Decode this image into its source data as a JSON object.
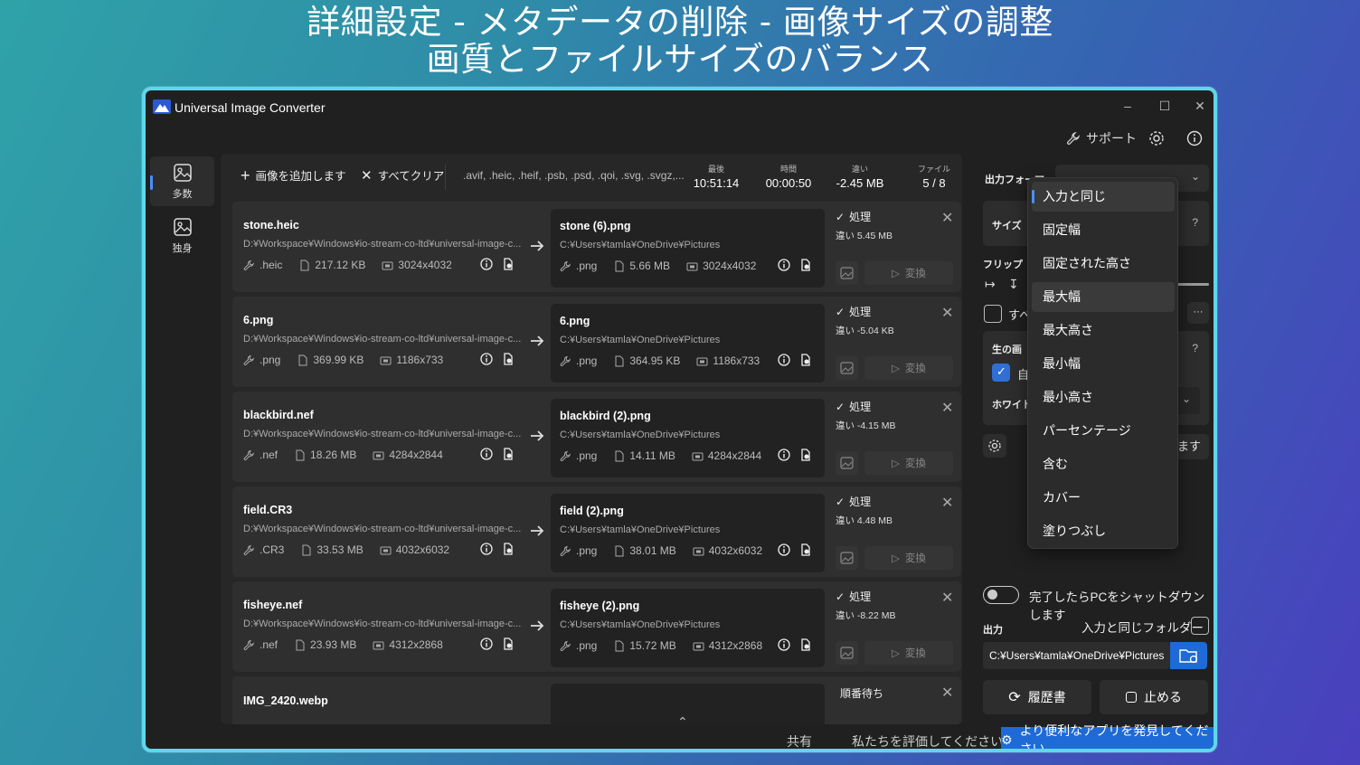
{
  "headline": {
    "line1": "詳細設定 - メタデータの削除 - 画像サイズの調整",
    "line2": "画質とファイルサイズのバランス"
  },
  "window": {
    "title": "Universal Image Converter",
    "support_label": "サポート"
  },
  "nav": [
    {
      "label": "多数"
    },
    {
      "label": "独身"
    }
  ],
  "toolbar": {
    "add_label": "画像を追加します",
    "clear_label": "すべてクリア",
    "extensions": ".avif, .heic, .heif, .psb, .psd, .qoi, .svg, .svgz,...",
    "stats": [
      {
        "label": "最後",
        "value": "10:51:14"
      },
      {
        "label": "時間",
        "value": "00:00:50"
      },
      {
        "label": "違い",
        "value": "-2.45 MB"
      },
      {
        "label": "ファイル",
        "value": "5 / 8"
      }
    ]
  },
  "files": [
    {
      "name": "stone.heic",
      "path": "D:¥Workspace¥Windows¥io-stream-co-ltd¥universal-image-c...",
      "ext": ".heic",
      "size": "217.12 KB",
      "dims": "3024x4032",
      "out": {
        "name": "stone (6).png",
        "path": "C:¥Users¥tamla¥OneDrive¥Pictures",
        "ext": ".png",
        "size": "5.66 MB",
        "dims": "3024x4032"
      },
      "status": "処理",
      "diff": "違い 5.45 MB",
      "convert": "変換"
    },
    {
      "name": "6.png",
      "path": "D:¥Workspace¥Windows¥io-stream-co-ltd¥universal-image-c...",
      "ext": ".png",
      "size": "369.99 KB",
      "dims": "1186x733",
      "out": {
        "name": "6.png",
        "path": "C:¥Users¥tamla¥OneDrive¥Pictures",
        "ext": ".png",
        "size": "364.95 KB",
        "dims": "1186x733"
      },
      "status": "処理",
      "diff": "違い -5.04 KB",
      "convert": "変換"
    },
    {
      "name": "blackbird.nef",
      "path": "D:¥Workspace¥Windows¥io-stream-co-ltd¥universal-image-c...",
      "ext": ".nef",
      "size": "18.26 MB",
      "dims": "4284x2844",
      "out": {
        "name": "blackbird (2).png",
        "path": "C:¥Users¥tamla¥OneDrive¥Pictures",
        "ext": ".png",
        "size": "14.11 MB",
        "dims": "4284x2844"
      },
      "status": "処理",
      "diff": "違い -4.15 MB",
      "convert": "変換"
    },
    {
      "name": "field.CR3",
      "path": "D:¥Workspace¥Windows¥io-stream-co-ltd¥universal-image-c...",
      "ext": ".CR3",
      "size": "33.53 MB",
      "dims": "4032x6032",
      "out": {
        "name": "field (2).png",
        "path": "C:¥Users¥tamla¥OneDrive¥Pictures",
        "ext": ".png",
        "size": "38.01 MB",
        "dims": "4032x6032"
      },
      "status": "処理",
      "diff": "違い 4.48 MB",
      "convert": "変換"
    },
    {
      "name": "fisheye.nef",
      "path": "D:¥Workspace¥Windows¥io-stream-co-ltd¥universal-image-c...",
      "ext": ".nef",
      "size": "23.93 MB",
      "dims": "4312x2868",
      "out": {
        "name": "fisheye (2).png",
        "path": "C:¥Users¥tamla¥OneDrive¥Pictures",
        "ext": ".png",
        "size": "15.72 MB",
        "dims": "4312x2868"
      },
      "status": "処理",
      "diff": "違い -8.22 MB",
      "convert": "変換"
    }
  ],
  "pending": {
    "name": "IMG_2420.webp",
    "status": "順番待ち"
  },
  "settings": {
    "output_format_label": "出力フォーマ",
    "size_label": "サイズ",
    "flip_label": "フリップ",
    "select_all_partial": "すべ",
    "raw_label_partial": "生の画",
    "auto_partial": "自",
    "white_partial": "ホワイト",
    "apply_partial": "します",
    "question": "?",
    "more": "···"
  },
  "size_menu": [
    "入力と同じ",
    "固定幅",
    "固定された高さ",
    "最大幅",
    "最大高さ",
    "最小幅",
    "最小高さ",
    "パーセンテージ",
    "含む",
    "カバー",
    "塗りつぶし"
  ],
  "shutdown_label": "完了したらPCをシャットダウンします",
  "output": {
    "label": "出力",
    "same_folder_label": "入力と同じフォルダー",
    "path": "C:¥Users¥tamla¥OneDrive¥Pictures"
  },
  "buttons": {
    "history": "履歴書",
    "stop": "止める"
  },
  "footer": {
    "share": "共有",
    "rate": "私たちを評価してください",
    "discover": "より便利なアプリを発見してください"
  },
  "colors": {
    "accent": "#1e6ad6",
    "frame": "#5fd7ea",
    "window_bg": "#202020"
  }
}
